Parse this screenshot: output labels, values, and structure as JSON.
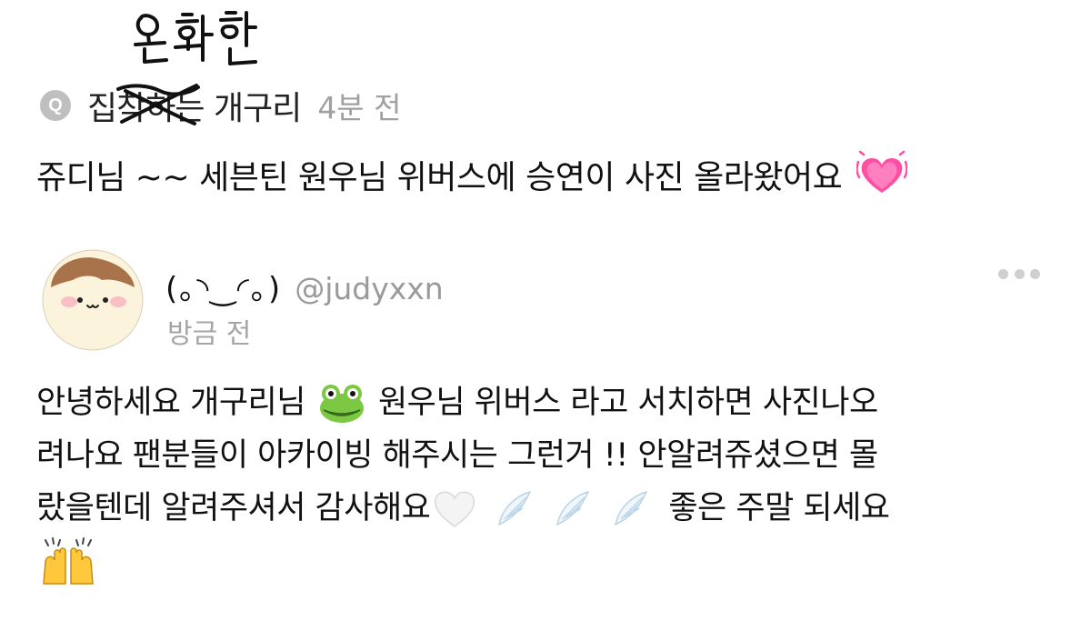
{
  "question": {
    "badge": "Q",
    "asker_prefix": "집",
    "asker_struck": "착하",
    "asker_suffix": "는 개구리",
    "handwritten_correction": "온화한",
    "time": "4분 전",
    "text": "쥬디님 ~~ 세븐틴 원우님 위버스에 승연이 사진 올라왔어요",
    "emoji_icon": "growing-heart-icon"
  },
  "answer": {
    "display_name": "(｡◝‿◜｡)",
    "handle": "@judyxxn",
    "time": "방금 전",
    "more_icon": "more-dots-icon",
    "lines": [
      "안녕하세요 개구리님",
      "원우님 위버스 라고 서치하면 사진나오",
      "려나요 팬분들이 아카이빙 해주시는 그런거 !! 안알려쥬셨으면 몰",
      "랐을텐데 알려주셔서 감사해요",
      "좋은 주말 되세요"
    ],
    "emojis": [
      "frog-icon",
      "white-heart-icon",
      "wing-icon",
      "raising-hands-icon"
    ]
  },
  "colors": {
    "background": "#ffffff",
    "text": "#111111",
    "muted": "#a0a0a0",
    "badge": "#bfbfbf",
    "heart": "#ff4fa3"
  }
}
